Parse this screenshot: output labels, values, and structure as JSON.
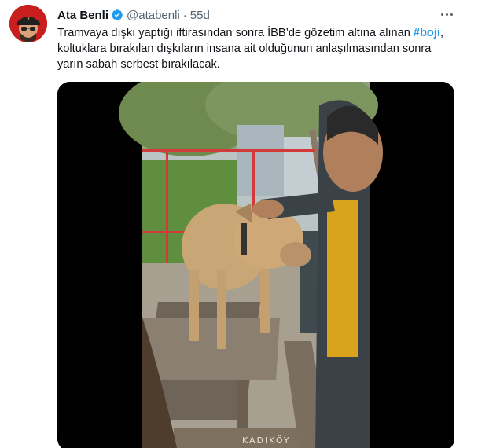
{
  "tweet": {
    "author_name": "Ata Benli",
    "handle": "@atabenli",
    "separator": "·",
    "time": "55d",
    "text_line1_pre": "Tramvaya dışkı yaptığı iftirasından sonra İBB’de gözetim altına alınan ",
    "hashtag": "#boji",
    "text_line1_post": ",",
    "text_line2": "koltuklara bırakılan dışkıların insana ait olduğunun anlaşılmasından sonra",
    "text_line3": "yarın sabah serbest bırakılacak."
  },
  "media": {
    "bench_text": "KADIKÖY"
  },
  "icons": {
    "verified": "verified-badge-icon",
    "more": "more-options-icon"
  },
  "colors": {
    "accent": "#1d9bf0",
    "text": "#0f1419",
    "secondary": "#536471",
    "avatar_bg": "#c81e1e"
  }
}
